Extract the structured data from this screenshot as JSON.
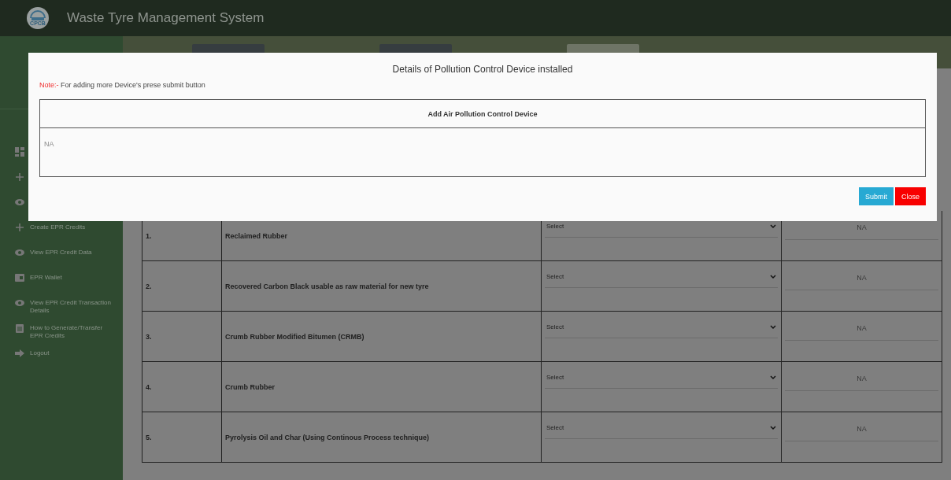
{
  "header": {
    "title": "Waste Tyre Management System",
    "logo_text": "CPCB"
  },
  "tabs": [
    {
      "selected": false
    },
    {
      "selected": false
    },
    {
      "selected": true
    }
  ],
  "sidebar": {
    "items": [
      {
        "kind": "dashboard"
      },
      {
        "kind": "plus"
      },
      {
        "kind": "eye"
      },
      {
        "kind": "plus",
        "label": "Create EPR Credits"
      },
      {
        "kind": "eye",
        "label": "View EPR Credit Data"
      },
      {
        "kind": "wallet",
        "label": "EPR Wallet"
      },
      {
        "kind": "eye",
        "label": "View EPR Credit Transaction Details"
      },
      {
        "kind": "clipboard",
        "label": "How to Generate/Transfer EPR Credits"
      },
      {
        "kind": "logout",
        "label": "Logout"
      }
    ]
  },
  "table": {
    "rows": [
      {
        "number": "1.",
        "product": "Reclaimed Rubber",
        "select": "Select",
        "value_placeholder": "NA"
      },
      {
        "number": "2.",
        "product": "Recovered Carbon Black usable as raw material for new tyre",
        "select": "Select",
        "value_placeholder": "NA"
      },
      {
        "number": "3.",
        "product": "Crumb Rubber Modified Bitumen (CRMB)",
        "select": "Select",
        "value_placeholder": "NA"
      },
      {
        "number": "4.",
        "product": "Crumb Rubber",
        "select": "Select",
        "value_placeholder": "NA"
      },
      {
        "number": "5.",
        "product": "Pyrolysis Oil and Char (Using Continous Process technique)",
        "select": "Select",
        "value_placeholder": "NA"
      }
    ]
  },
  "modal": {
    "title": "Details of Pollution Control Device installed",
    "note_label": "Note:-",
    "note": "For adding more Device's prese submit button",
    "section_title": "Add Air Pollution Control Device",
    "input_placeholder": "NA",
    "buttons": [
      {
        "kind": "submit",
        "label": "Submit"
      },
      {
        "kind": "close",
        "label": "Close"
      }
    ]
  }
}
